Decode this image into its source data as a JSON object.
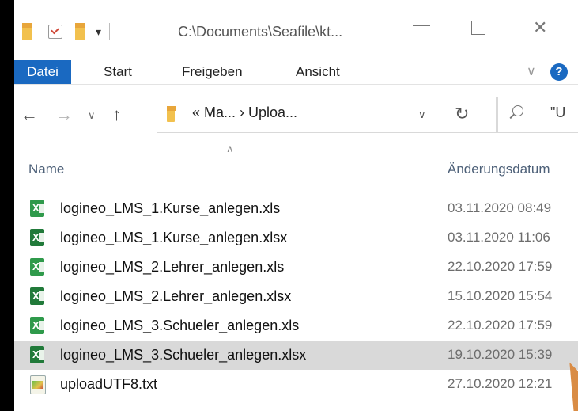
{
  "titlebar": {
    "path": "C:\\Documents\\Seafile\\kt...",
    "minimize_icon": "minimize-icon",
    "maximize_icon": "maximize-icon",
    "close_icon": "close-icon"
  },
  "ribbon": {
    "tabs": [
      {
        "label": "Datei",
        "active": true
      },
      {
        "label": "Start"
      },
      {
        "label": "Freigeben"
      },
      {
        "label": "Ansicht"
      }
    ],
    "help": "?"
  },
  "nav": {
    "address": "«  Ma...  ›  Uploa...",
    "search_placeholder": "\"U"
  },
  "columns": {
    "name": "Name",
    "date": "Änderungsdatum"
  },
  "files": [
    {
      "name": "logineo_LMS_1.Kurse_anlegen.xls",
      "date": "03.11.2020 08:49",
      "type": "xls"
    },
    {
      "name": "logineo_LMS_1.Kurse_anlegen.xlsx",
      "date": "03.11.2020 11:06",
      "type": "xlsx"
    },
    {
      "name": "logineo_LMS_2.Lehrer_anlegen.xls",
      "date": "22.10.2020 17:59",
      "type": "xls"
    },
    {
      "name": "logineo_LMS_2.Lehrer_anlegen.xlsx",
      "date": "15.10.2020 15:54",
      "type": "xlsx"
    },
    {
      "name": "logineo_LMS_3.Schueler_anlegen.xls",
      "date": "22.10.2020 17:59",
      "type": "xls"
    },
    {
      "name": "logineo_LMS_3.Schueler_anlegen.xlsx",
      "date": "19.10.2020 15:39",
      "type": "xlsx",
      "selected": true
    },
    {
      "name": "uploadUTF8.txt",
      "date": "27.10.2020 12:21",
      "type": "txt"
    }
  ],
  "colors": {
    "accent": "#1a69c1",
    "selected_row": "#d9d9d9"
  }
}
